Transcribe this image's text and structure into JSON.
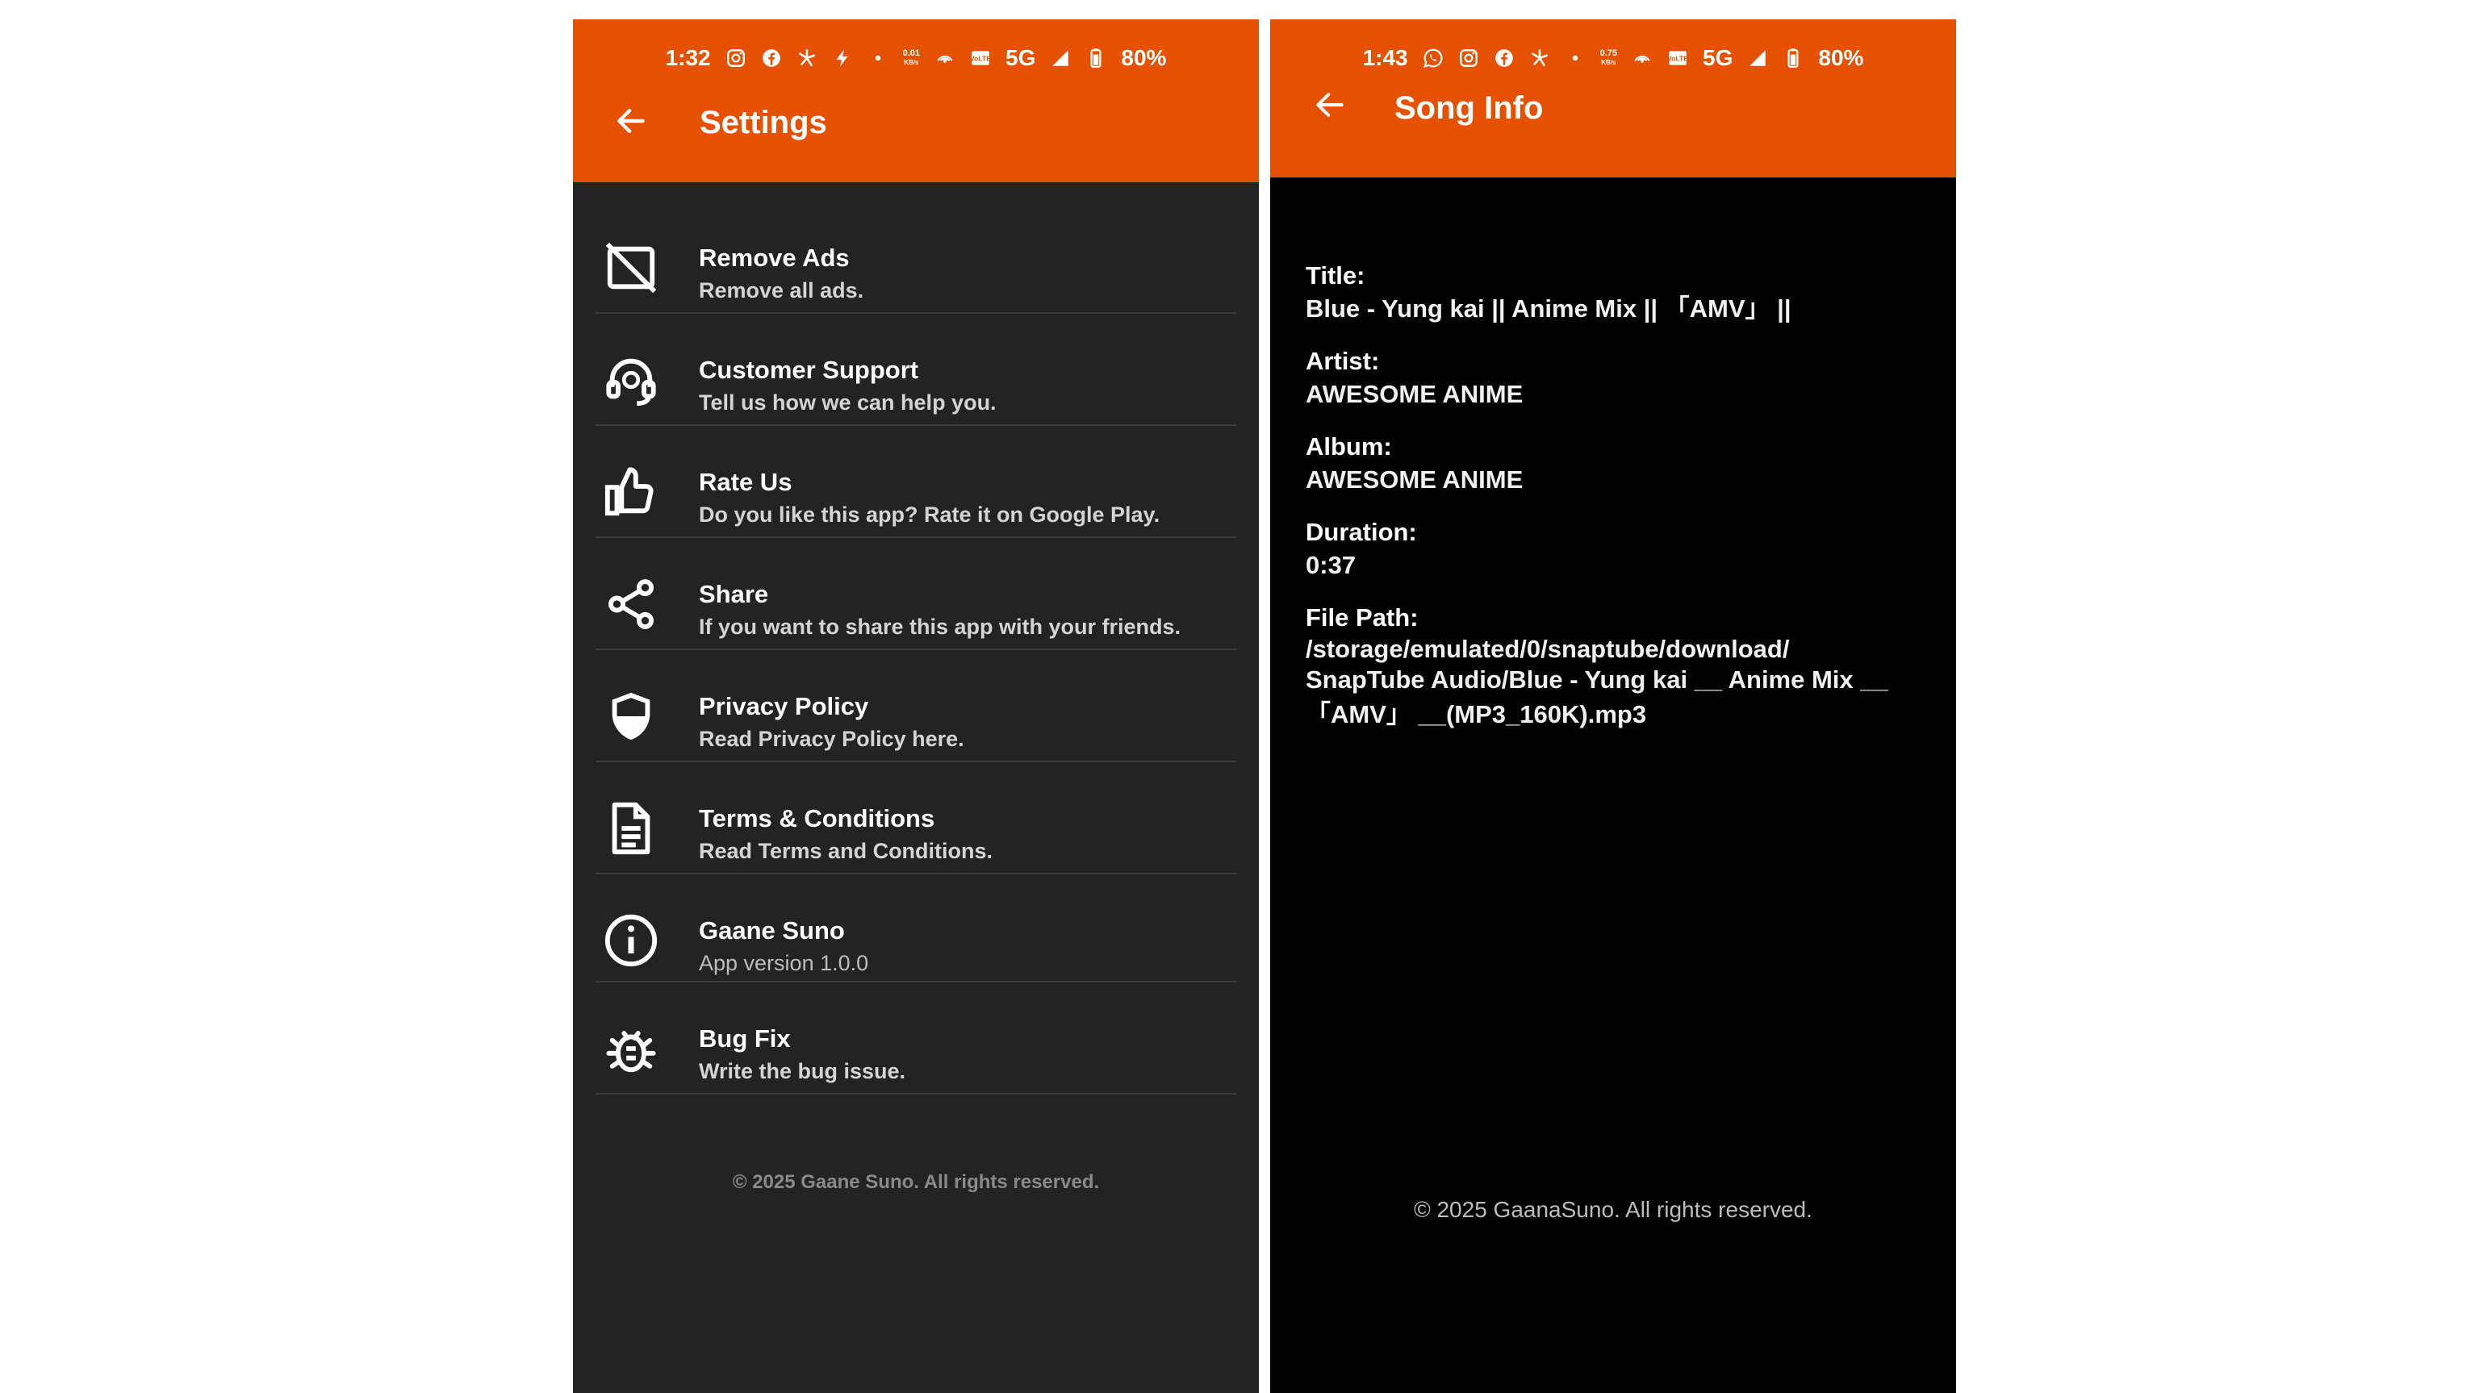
{
  "left_screen": {
    "status_bar": {
      "time": "1:32",
      "speed_value": "0.01",
      "speed_unit": "KB/s",
      "network": "5G",
      "battery": "80%",
      "icons": [
        "instagram-icon",
        "facebook-icon",
        "pinwheel-icon",
        "bolt-icon",
        "dot-icon",
        "hotspot-icon",
        "volte-icon",
        "signal-icon",
        "battery-icon"
      ]
    },
    "header": {
      "title": "Settings",
      "back_icon": "arrow-left-icon"
    },
    "items": [
      {
        "title": "Remove Ads",
        "subtitle": "Remove all ads.",
        "icon": "no-ads-icon"
      },
      {
        "title": "Customer Support",
        "subtitle": "Tell us how we can help you.",
        "icon": "headset-icon"
      },
      {
        "title": "Rate Us",
        "subtitle": "Do you like this app? Rate it on Google Play.",
        "icon": "thumbs-up-icon"
      },
      {
        "title": "Share",
        "subtitle": "If you want to share this app with your friends.",
        "icon": "share-icon"
      },
      {
        "title": "Privacy Policy",
        "subtitle": "Read Privacy Policy here.",
        "icon": "shield-icon"
      },
      {
        "title": "Terms & Conditions",
        "subtitle": "Read Terms and Conditions.",
        "icon": "document-icon"
      },
      {
        "title": "Gaane Suno",
        "subtitle": "App version 1.0.0",
        "icon": "info-icon"
      },
      {
        "title": "Bug Fix",
        "subtitle": "Write the bug issue.",
        "icon": "bug-icon"
      }
    ],
    "footer": "© 2025 Gaane Suno. All rights reserved."
  },
  "right_screen": {
    "status_bar": {
      "time": "1:43",
      "speed_value": "0.75",
      "speed_unit": "KB/s",
      "network": "5G",
      "battery": "80%",
      "icons": [
        "whatsapp-icon",
        "instagram-icon",
        "facebook-icon",
        "pinwheel-icon",
        "dot-icon",
        "hotspot-icon",
        "volte-icon",
        "signal-icon",
        "battery-icon"
      ]
    },
    "header": {
      "title": "Song Info",
      "back_icon": "arrow-left-icon"
    },
    "fields": {
      "title_label": "Title:",
      "title_value": "Blue - Yung kai || Anime Mix || 「AMV」 ||",
      "artist_label": "Artist:",
      "artist_value": "AWESOME ANIME",
      "album_label": "Album:",
      "album_value": "AWESOME ANIME",
      "duration_label": "Duration:",
      "duration_value": "0:37",
      "path_label": "File Path:",
      "path_line1": "/storage/emulated/0/snaptube/download/",
      "path_line2": "SnapTube Audio/Blue - Yung kai __ Anime Mix __",
      "path_line3": "「AMV」 __(MP3_160K).mp3"
    },
    "footer": "© 2025 GaanaSuno. All rights reserved."
  },
  "colors": {
    "accent": "#e55100",
    "settings_bg": "#232323",
    "songinfo_bg": "#000000"
  }
}
